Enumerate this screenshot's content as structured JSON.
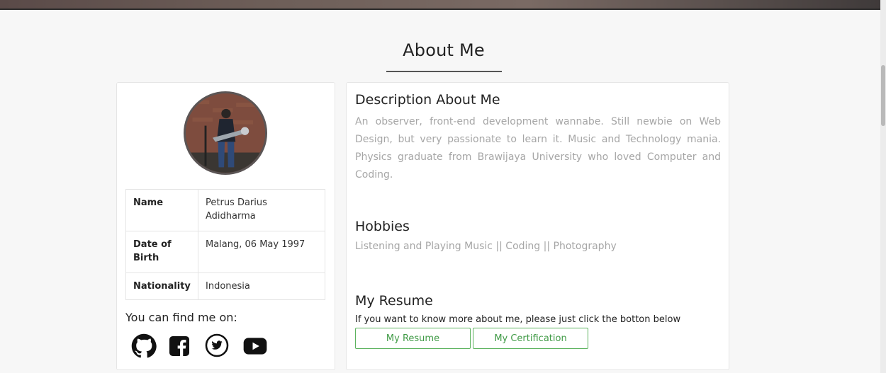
{
  "section": {
    "title": "About Me"
  },
  "profile": {
    "rows": [
      {
        "label": "Name",
        "value": "Petrus Darius Adidharma"
      },
      {
        "label": "Date of Birth",
        "value": "Malang, 06 May 1997"
      },
      {
        "label": "Nationality",
        "value": "Indonesia"
      }
    ],
    "find_me_label": "You can find me on:",
    "socials": [
      "github-icon",
      "facebook-icon",
      "twitter-icon",
      "youtube-icon"
    ]
  },
  "about": {
    "description_title": "Description About Me",
    "description_text": "An observer, front-end development wannabe. Still newbie on Web Design, but very passionate to learn it. Music and Technology mania. Physics graduate from Brawijaya University who loved Computer and Coding.",
    "hobbies_title": "Hobbies",
    "hobbies_text": "Listening and Playing Music || Coding || Photography",
    "resume_title": "My Resume",
    "resume_hint": "If you want to know more about me, please just click the botton below",
    "resume_button": "My Resume",
    "certification_button": "My Certification"
  },
  "colors": {
    "accent_green": "#3f9a45",
    "text_muted": "#a6a6a6",
    "title_dark": "#222222"
  }
}
